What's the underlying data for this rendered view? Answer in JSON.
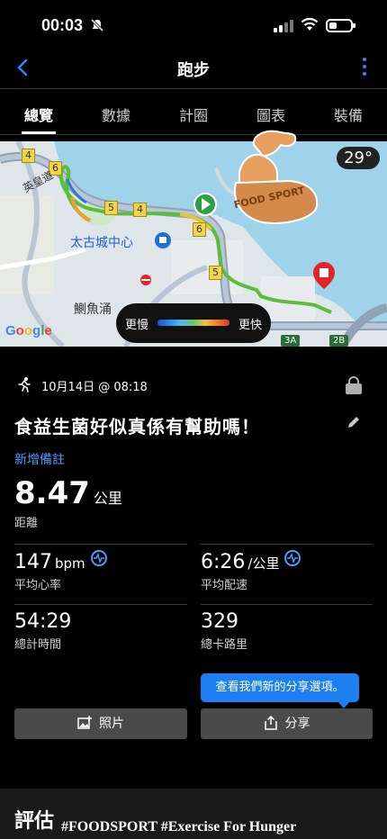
{
  "status_bar": {
    "time": "00:03"
  },
  "nav": {
    "title": "跑步"
  },
  "tabs": [
    {
      "label": "總覽"
    },
    {
      "label": "數據"
    },
    {
      "label": "計圈"
    },
    {
      "label": "圖表"
    },
    {
      "label": "裝備"
    }
  ],
  "map": {
    "temperature": "29°",
    "legend_slow": "更慢",
    "legend_fast": "更快",
    "labels": {
      "taikoo": "太古城中心",
      "quarry_bay": "鰂魚涌",
      "road": "英皇道",
      "exit_3a": "3A",
      "exit_2b": "2B"
    },
    "road_numbers": [
      "4",
      "6",
      "5",
      "4",
      "6",
      "5"
    ],
    "google_logo": [
      "G",
      "o",
      "o",
      "g",
      "l",
      "e"
    ]
  },
  "sticker": {
    "text": "FOOD SPORT"
  },
  "activity": {
    "date": "10月14日 @ 08:18",
    "title": "食益生菌好似真係有幫助嗎！",
    "add_note": "新增備註",
    "distance": {
      "value": "8.47",
      "unit": "公里",
      "label": "距離"
    },
    "stats": {
      "heart_rate": {
        "value": "147",
        "unit": "bpm",
        "label": "平均心率"
      },
      "pace": {
        "value": "6:26",
        "unit": "/公里",
        "label": "平均配速"
      },
      "time": {
        "value": "54:29",
        "label": "總計時間"
      },
      "calories": {
        "value": "329",
        "label": "總卡路里"
      }
    }
  },
  "tooltip": "查看我們新的分享選項。",
  "buttons": {
    "photos": "照片",
    "share": "分享"
  },
  "section": {
    "evaluation": "評估"
  },
  "watermark": "#FOODSPORT #Exercise For Hunger",
  "colors": {
    "accent": "#2f86ff",
    "link": "#4a9bff",
    "tooltip": "#1d7ff0",
    "start": "#2ea043",
    "end": "#e0242a"
  }
}
